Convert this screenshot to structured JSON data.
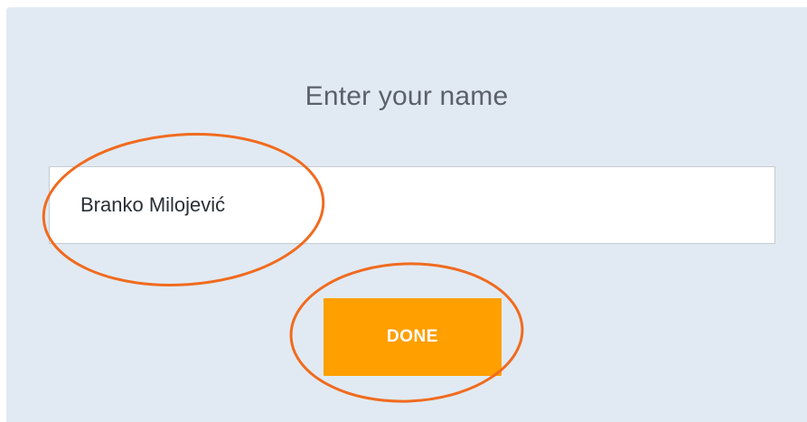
{
  "form": {
    "title": "Enter your name",
    "name_value": "Branko Milojević",
    "done_label": "DONE"
  },
  "colors": {
    "panel_background": "#e1eaf2",
    "button_background": "#ff9f00",
    "annotation_stroke": "#f06b1f"
  }
}
